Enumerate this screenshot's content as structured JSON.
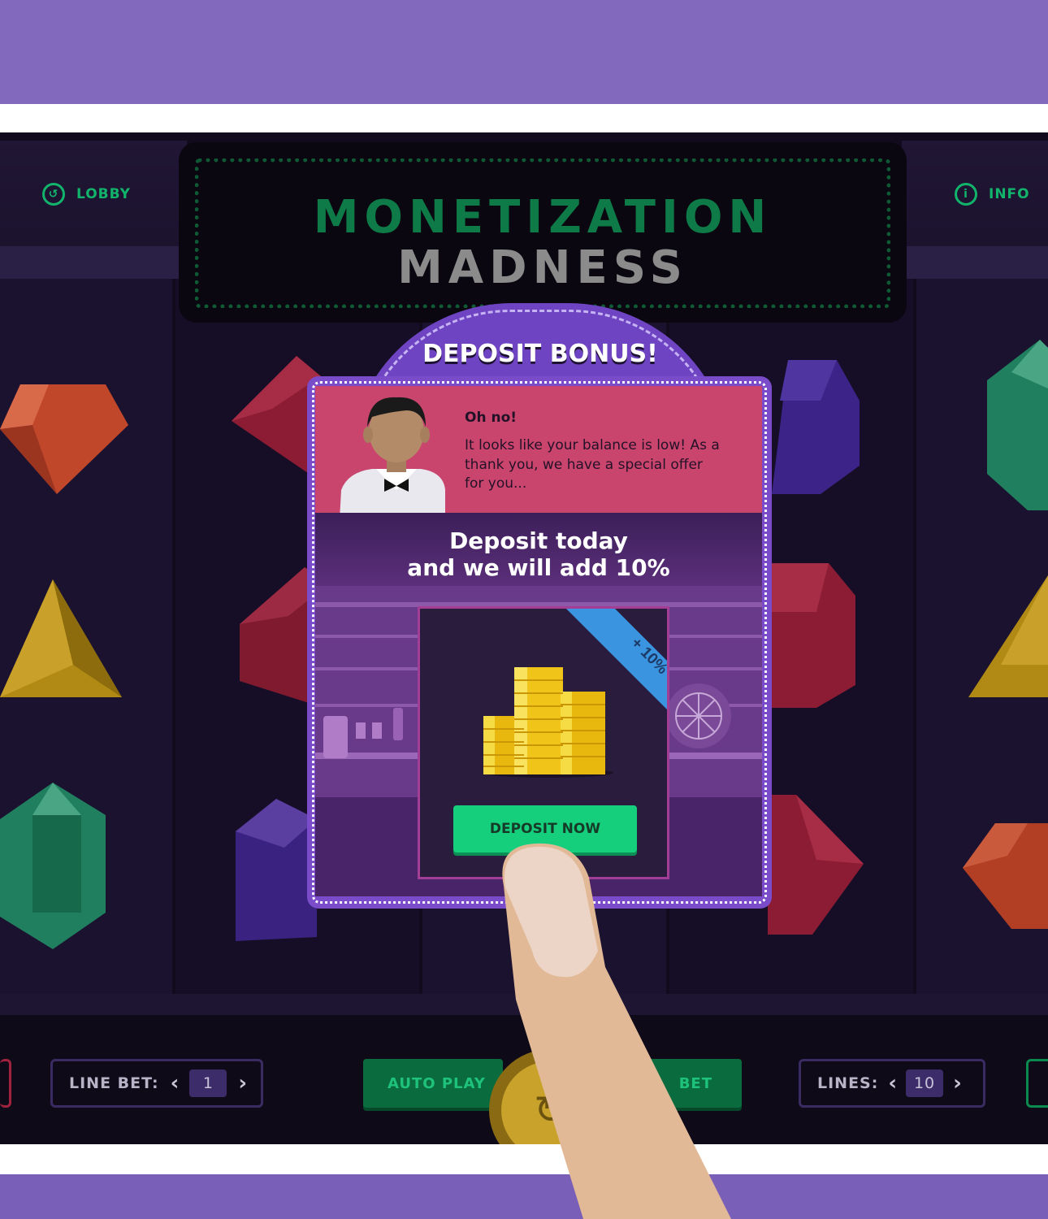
{
  "game": {
    "title_line1": "MONETIZATION",
    "title_line2": "MADNESS"
  },
  "nav": {
    "lobby_label": "LOBBY",
    "lobby_icon": "back-arrow-icon",
    "info_label": "INFO",
    "info_icon": "info-icon",
    "info_glyph": "i"
  },
  "popup": {
    "title": "DEPOSIT BONUS!",
    "greeting": "Oh no!",
    "message": "It looks like your balance is low! As a thank you, we have a special offer for you...",
    "headline_line1": "Deposit today",
    "headline_line2": "and we will add 10%",
    "ribbon": "+ 10%",
    "button_label": "DEPOSIT NOW"
  },
  "controls": {
    "line_bet_label": "LINE BET:",
    "line_bet_value": "1",
    "auto_play_label": "AUTO PLAY",
    "bet_label": "BET",
    "lines_label": "LINES:",
    "lines_value": "10",
    "arrow_left": "‹",
    "arrow_right": "›"
  },
  "colors": {
    "brand_purple": "#8369bd",
    "accent_green": "#16cf7d",
    "popup_pink": "#c9456e",
    "ribbon_blue": "#3a94e0"
  }
}
